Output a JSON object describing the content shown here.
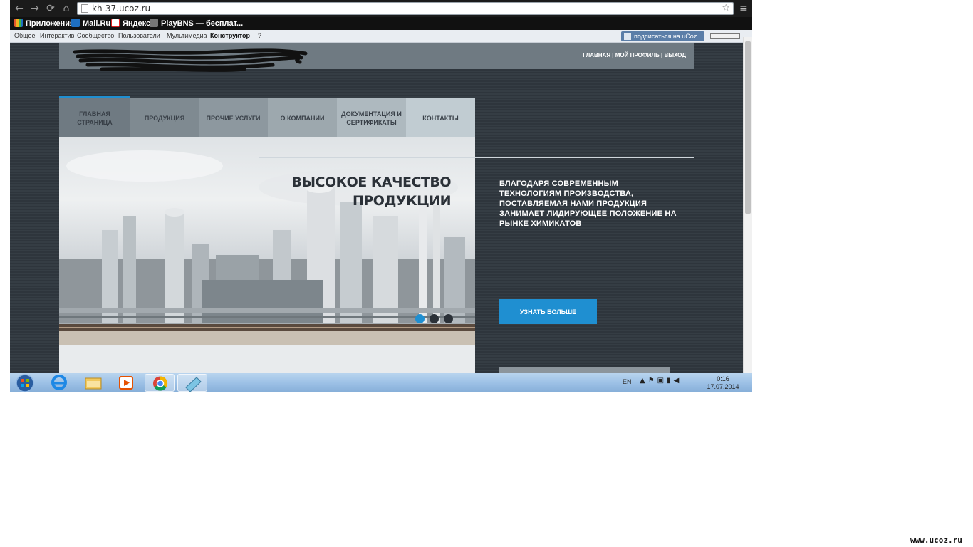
{
  "browser": {
    "url": "kh-37.ucoz.ru",
    "nav_glyphs": {
      "back": "←",
      "forward": "→",
      "reload": "⟳",
      "home": "⌂",
      "star": "☆",
      "menu": "≡"
    },
    "bookmarks": [
      {
        "label": "Приложения",
        "icon": "apps-grid-icon",
        "color": "#e4572e"
      },
      {
        "label": "Mail.Ru",
        "icon": "mailru-icon",
        "color": "#1e6fc1"
      },
      {
        "label": "Яндекс",
        "icon": "yandex-icon",
        "color": "#d22"
      },
      {
        "label": "PlayBNS — бесплат...",
        "icon": "playbns-icon",
        "color": "#444"
      }
    ]
  },
  "ucoz_panel": {
    "items": [
      "Общее",
      "Интерактив",
      "Сообщество",
      "Пользователи",
      "Мультимедиа",
      "Конструктор",
      "?"
    ],
    "subscribe_label": "подписаться на uCoz"
  },
  "site": {
    "user_links": "ГЛАВНАЯ | МОЙ ПРОФИЛЬ | ВЫХОД",
    "nav": [
      {
        "label": "ГЛАВНАЯ СТРАНИЦА",
        "bg": "#6f7a82",
        "active": true
      },
      {
        "label": "ПРОДУКЦИЯ",
        "bg": "#7f8a91"
      },
      {
        "label": "ПРОЧИЕ УСЛУГИ",
        "bg": "#8d989f"
      },
      {
        "label": "О КОМПАНИИ",
        "bg": "#9da8ae"
      },
      {
        "label": "ДОКУМЕНТАЦИЯ И СЕРТИФИКАТЫ",
        "bg": "#aeb9bf"
      },
      {
        "label": "КОНТАКТЫ",
        "bg": "#c1ccd2"
      }
    ],
    "slide": {
      "headline_line1": "ВЫСОКОЕ КАЧЕСТВО",
      "headline_line2": "ПРОДУКЦИИ"
    },
    "description": "БЛАГОДАРЯ СОВРЕМЕННЫМ ТЕХНОЛОГИЯМ ПРОИЗВОДСТВА, ПОСТАВЛЯЕМАЯ НАМИ ПРОДУКЦИЯ ЗАНИМАЕТ ЛИДИРУЮЩЕЕ ПОЛОЖЕНИЕ НА РЫНКЕ ХИМИКАТОВ",
    "more_button": "УЗНАТЬ БОЛЬШЕ",
    "accent_color": "#1f8fd1"
  },
  "taskbar": {
    "language": "EN",
    "time": "0:16",
    "date": "17.07.2014"
  },
  "watermark": "www.ucoz.ru"
}
